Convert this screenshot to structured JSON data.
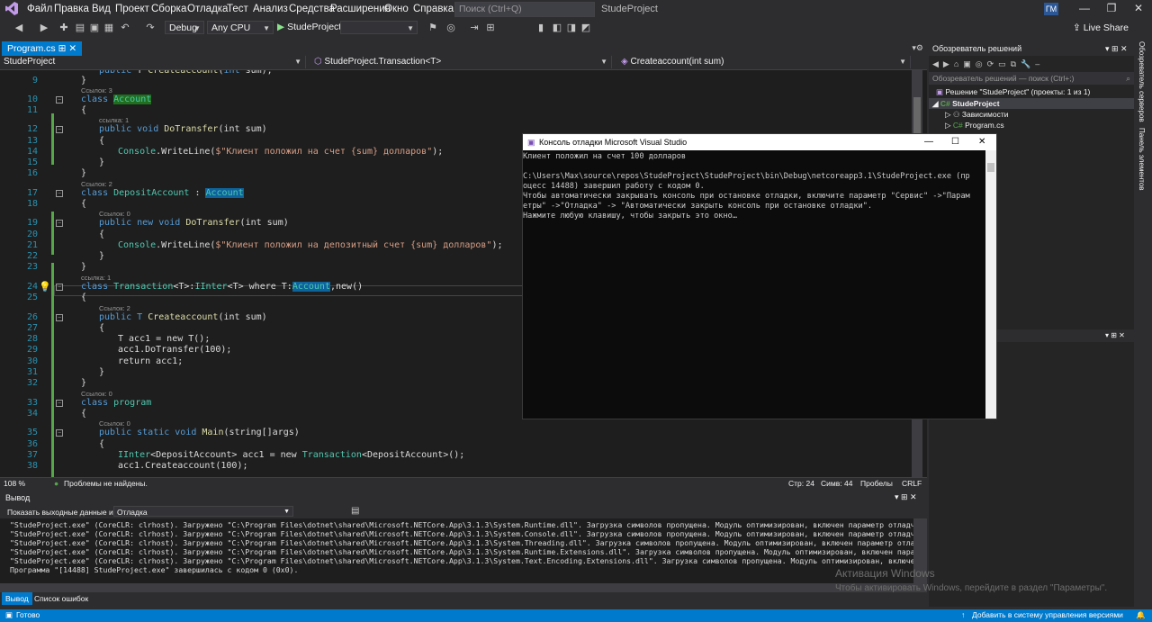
{
  "menu": [
    "Файл",
    "Правка",
    "Вид",
    "Проект",
    "Сборка",
    "Отладка",
    "Тест",
    "Анализ",
    "Средства",
    "Расширения",
    "Окно",
    "Справка"
  ],
  "search_placeholder": "Поиск (Ctrl+Q)",
  "window_title": "StudeProject",
  "avatar_initials": "ГМ",
  "toolbar": {
    "config": "Debug",
    "platform": "Any CPU",
    "run_target": "StudeProject",
    "live_share": "Live Share"
  },
  "tab": "Program.cs",
  "nav": {
    "project": "StudeProject",
    "class": "StudeProject.Transaction<T>",
    "member": "Createaccount(int sum)"
  },
  "code_lines": [
    {
      "n": "9"
    },
    {
      "n": "10"
    },
    {
      "n": "11"
    },
    {
      "n": "12"
    },
    {
      "n": "13"
    },
    {
      "n": "14"
    },
    {
      "n": "15"
    },
    {
      "n": "16"
    },
    {
      "n": "17"
    },
    {
      "n": "18"
    },
    {
      "n": "19"
    },
    {
      "n": "20"
    },
    {
      "n": "21"
    },
    {
      "n": "22"
    },
    {
      "n": "23"
    },
    {
      "n": "24"
    },
    {
      "n": "25"
    },
    {
      "n": "26"
    },
    {
      "n": "27"
    },
    {
      "n": "28"
    },
    {
      "n": "29"
    },
    {
      "n": "30"
    },
    {
      "n": "31"
    },
    {
      "n": "32"
    },
    {
      "n": "33"
    },
    {
      "n": "34"
    },
    {
      "n": "35"
    },
    {
      "n": "36"
    },
    {
      "n": "37"
    },
    {
      "n": "38"
    }
  ],
  "code_lens": {
    "l10": "Ссылок: 3",
    "l12": "ссылка: 1",
    "l17": "Ссылок: 2",
    "l19": "Ссылок: 0",
    "l24": "ссылка: 1",
    "l26": "Ссылок: 2",
    "l33": "Ссылок: 0",
    "l35": "Ссылок: 0"
  },
  "code_text": {
    "top": "public T Createaccount(int sum);",
    "l9": "}",
    "l10_kw": "class ",
    "l10_cls": "Account",
    "l11": "{",
    "l12_a": "public void ",
    "l12_b": "DoTransfer",
    "l12_c": "(int sum)",
    "l13": "{",
    "l14_a": "Console",
    "l14_b": ".WriteLine(",
    "l14_c": "$\"Клиент положил на счет {sum} долларов\"",
    "l14_d": ");",
    "l15": "}",
    "l16": "}",
    "l17_kw": "class ",
    "l17_cls": "DepositAccount",
    "l17_sep": " : ",
    "l17_base": "Account",
    "l18": "{",
    "l19_a": "public new void ",
    "l19_b": "DoTransfer",
    "l19_c": "(int sum)",
    "l20": "{",
    "l21_a": "Console",
    "l21_b": ".WriteLine(",
    "l21_c": "$\"Клиент положил на депозитный счет {sum} долларов\"",
    "l21_d": ");",
    "l22": "}",
    "l23": "}",
    "l24_a": "class ",
    "l24_b": "Transaction",
    "l24_c": "<T>:",
    "l24_d": "IInter",
    "l24_e": "<T> where T:",
    "l24_f": "Account",
    "l24_g": ",new()",
    "l25": "{",
    "l26_a": "public T ",
    "l26_b": "Createaccount",
    "l26_c": "(int sum)",
    "l27": "{",
    "l28_a": "T acc1 = new T();",
    "l29_a": "acc1.DoTransfer(100);",
    "l30_a": "return acc1;",
    "l31": "}",
    "l32": "}",
    "l33_a": "class ",
    "l33_b": "program",
    "l34": "{",
    "l35_a": "public static void ",
    "l35_b": "Main",
    "l35_c": "(string[]args)",
    "l36": "{",
    "l37_a": "IInter",
    "l37_b": "<DepositAccount>",
    "l37_c": " acc1 = new ",
    "l37_d": "Transaction",
    "l37_e": "<DepositAccount>",
    "l37_f": "();",
    "l38_a": "acc1.Createaccount(100);"
  },
  "editor_status": {
    "zoom": "108 %",
    "issues": "Проблемы не найдены.",
    "line": "Стр: 24",
    "chars": "Симв: 44",
    "spaces": "Пробелы",
    "eol": "CRLF"
  },
  "output": {
    "title": "Вывод",
    "show_from_label": "Показать выходные данные из:",
    "source": "Отладка",
    "lines": [
      "\"StudeProject.exe\" (CoreCLR: clrhost). Загружено \"C:\\Program Files\\dotnet\\shared\\Microsoft.NETCore.App\\3.1.3\\System.Runtime.dll\". Загрузка символов пропущена. Модуль оптимизирован, включен параметр отладчика \"Только",
      "\"StudeProject.exe\" (CoreCLR: clrhost). Загружено \"C:\\Program Files\\dotnet\\shared\\Microsoft.NETCore.App\\3.1.3\\System.Console.dll\". Загрузка символов пропущена. Модуль оптимизирован, включен параметр отладчика \"Только",
      "\"StudeProject.exe\" (CoreCLR: clrhost). Загружено \"C:\\Program Files\\dotnet\\shared\\Microsoft.NETCore.App\\3.1.3\\System.Threading.dll\". Загрузка символов пропущена. Модуль оптимизирован, включен параметр отладчика \"Толь",
      "\"StudeProject.exe\" (CoreCLR: clrhost). Загружено \"C:\\Program Files\\dotnet\\shared\\Microsoft.NETCore.App\\3.1.3\\System.Runtime.Extensions.dll\". Загрузка символов пропущена. Модуль оптимизирован, включен параметр отлад",
      "\"StudeProject.exe\" (CoreCLR: clrhost). Загружено \"C:\\Program Files\\dotnet\\shared\\Microsoft.NETCore.App\\3.1.3\\System.Text.Encoding.Extensions.dll\". Загрузка символов пропущена. Модуль оптимизирован, включен параметр",
      "Программа \"[14488] StudeProject.exe\" завершилась с кодом 0 (0x0)."
    ]
  },
  "bottom_tabs": {
    "output": "Вывод",
    "errors": "Список ошибок"
  },
  "status": {
    "ready": "Готово",
    "add_to_vcs": "Добавить в систему управления версиями"
  },
  "solution": {
    "title": "Обозреватель решений",
    "search": "Обозреватель решений — поиск (Ctrl+;)",
    "root": "Решение \"StudeProject\" (проекты: 1 из 1)",
    "project": "StudeProject",
    "deps": "Зависимости",
    "file": "Program.cs"
  },
  "right_rail": {
    "sol": "Обозреватель серверов",
    "toolbox": "Панель элементов"
  },
  "console": {
    "title": "Консоль отладки Microsoft Visual Studio",
    "lines": [
      "Клиент положил на счет 100 долларов",
      "",
      "C:\\Users\\Max\\source\\repos\\StudeProject\\StudeProject\\bin\\Debug\\netcoreapp3.1\\StudeProject.exe (пр",
      "оцесс 14488) завершил работу с кодом 0.",
      "Чтобы автоматически закрывать консоль при остановке отладки, включите параметр \"Сервис\" ->\"Парам",
      "етры\" ->\"Отладка\" -> \"Автоматически закрыть консоль при остановке отладки\".",
      "Нажмите любую клавишу, чтобы закрыть это окно…"
    ]
  },
  "watermark": {
    "title": "Активация Windows",
    "text": "Чтобы активировать Windows, перейдите в раздел \"Параметры\"."
  },
  "colors": {
    "accent": "#007acc",
    "editor_bg": "#1e1e1e",
    "console_bg": "#0c0c0c"
  }
}
